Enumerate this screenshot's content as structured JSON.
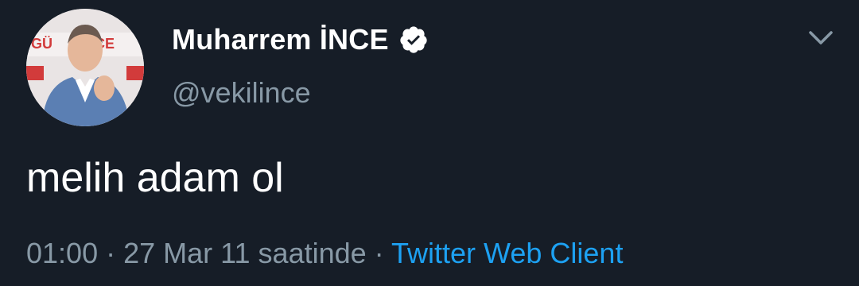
{
  "tweet": {
    "author": {
      "display_name": "Muharrem İNCE",
      "handle": "@vekilince",
      "verified": true,
      "avatar_text": "GÜVENCE"
    },
    "text": "melih adam ol",
    "time": "01:00",
    "separator": "·",
    "date": "27 Mar 11 saatinde",
    "source": "Twitter Web Client",
    "colors": {
      "background": "#161d27",
      "text": "#ffffff",
      "muted": "#8899a6",
      "link": "#1da1f2"
    }
  }
}
